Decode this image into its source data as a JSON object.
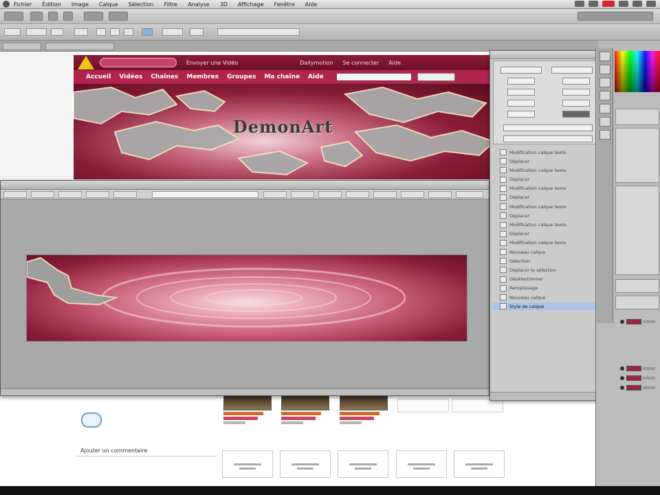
{
  "menu": {
    "items": [
      "Fichier",
      "Édition",
      "Image",
      "Calque",
      "Sélection",
      "Filtre",
      "Analyse",
      "3D",
      "Affichage",
      "Fenêtre",
      "Aide"
    ]
  },
  "website": {
    "top_links": [
      "Envoyer une Vidéo",
      "Dailymotion",
      "Se connecter",
      "Aide"
    ],
    "nav_items": [
      "Accueil",
      "Vidéos",
      "Chaînes",
      "Membres",
      "Groupes",
      "Ma chaîne",
      "Aide"
    ],
    "search_button": "Recherche",
    "banner_title": "DemonArt",
    "comment_label": "Ajouter un commentaire"
  },
  "history_panel": {
    "items": [
      "Modification calque texte",
      "Déplacer",
      "Modification calque texte",
      "Déplacer",
      "Modification calque texte",
      "Déplacer",
      "Modification calque texte",
      "Déplacer",
      "Modification calque texte",
      "Déplacer",
      "Modification calque texte",
      "Nouveau calque",
      "Sélection",
      "Déplacer la sélection",
      "Désélectionner",
      "Remplissage",
      "Nouveau calque",
      "Style de calque"
    ],
    "selected_index": 17
  },
  "colors": {
    "site_dark": "#6e0f28",
    "site_nav": "#b0254e",
    "canvas_center": "#f7dde3",
    "canvas_edge": "#6b1229",
    "selection": "#a9c4e6"
  }
}
